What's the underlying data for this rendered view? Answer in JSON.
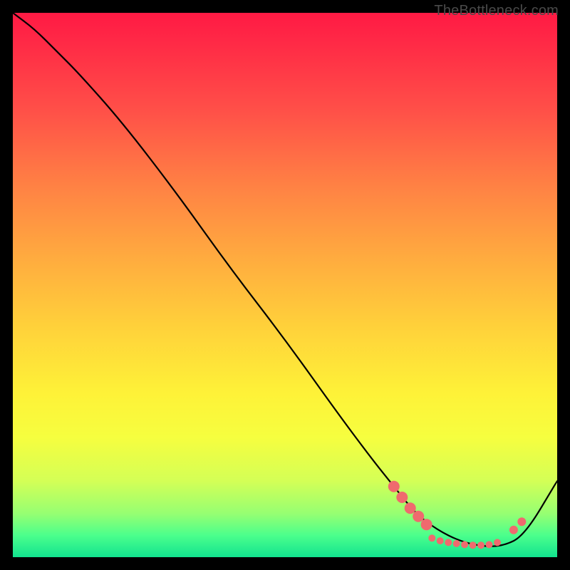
{
  "watermark": "TheBottleneck.com",
  "chart_data": {
    "type": "line",
    "title": "",
    "xlabel": "",
    "ylabel": "",
    "xlim": [
      0,
      100
    ],
    "ylim": [
      0,
      100
    ],
    "grid": false,
    "series": [
      {
        "name": "curve",
        "color": "#000000",
        "x": [
          0,
          4,
          8,
          12,
          20,
          30,
          40,
          50,
          60,
          66,
          70,
          74,
          78,
          82,
          86,
          90,
          94,
          100
        ],
        "y": [
          100,
          97,
          93,
          89,
          80,
          67,
          53,
          40,
          26,
          18,
          13,
          8,
          5,
          3,
          2,
          2,
          4,
          14
        ]
      }
    ],
    "markers": {
      "color": "#ef6a6e",
      "radius_small": 5,
      "radius_large": 8,
      "points": [
        {
          "x": 70.0,
          "y": 13.0,
          "r": 8
        },
        {
          "x": 71.5,
          "y": 11.0,
          "r": 8
        },
        {
          "x": 73.0,
          "y": 9.0,
          "r": 8
        },
        {
          "x": 74.5,
          "y": 7.5,
          "r": 8
        },
        {
          "x": 76.0,
          "y": 6.0,
          "r": 8
        },
        {
          "x": 77.0,
          "y": 3.5,
          "r": 5
        },
        {
          "x": 78.5,
          "y": 3.0,
          "r": 5
        },
        {
          "x": 80.0,
          "y": 2.7,
          "r": 5
        },
        {
          "x": 81.5,
          "y": 2.5,
          "r": 5
        },
        {
          "x": 83.0,
          "y": 2.3,
          "r": 5
        },
        {
          "x": 84.5,
          "y": 2.2,
          "r": 5
        },
        {
          "x": 86.0,
          "y": 2.2,
          "r": 5
        },
        {
          "x": 87.5,
          "y": 2.3,
          "r": 5
        },
        {
          "x": 89.0,
          "y": 2.7,
          "r": 5
        },
        {
          "x": 92.0,
          "y": 5.0,
          "r": 6
        },
        {
          "x": 93.5,
          "y": 6.5,
          "r": 6
        }
      ]
    }
  }
}
